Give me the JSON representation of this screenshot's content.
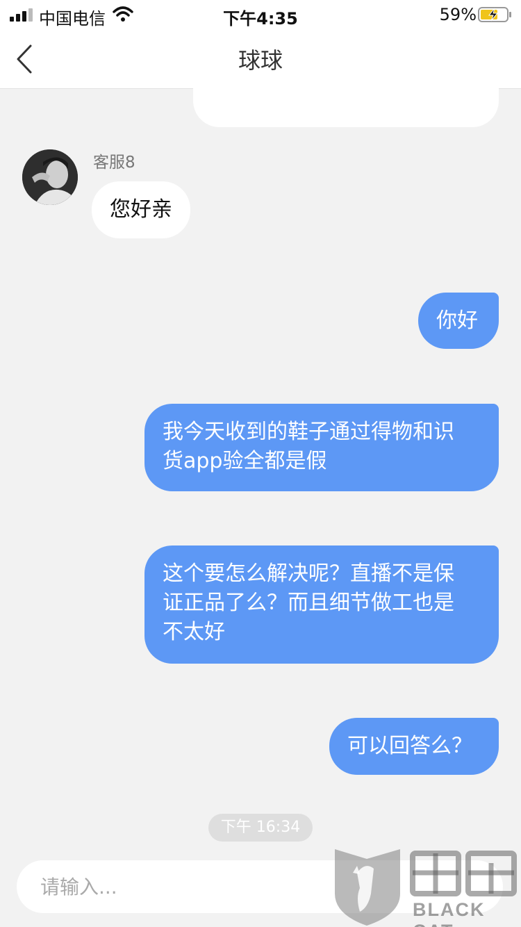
{
  "status_bar": {
    "carrier": "中国电信",
    "time": "下午4:35",
    "battery": "59%",
    "icons": [
      "signal-icon",
      "wifi-icon",
      "battery-charging-icon"
    ]
  },
  "nav": {
    "title": "球球",
    "back_icon": "chevron-left-icon"
  },
  "messages": [
    {
      "direction": "in",
      "sender": "客服8",
      "text": "您好亲"
    },
    {
      "direction": "out",
      "text": "你好"
    },
    {
      "direction": "out",
      "lines": [
        "我今天收到的鞋子通过得物和识",
        "货app验全都是假"
      ]
    },
    {
      "direction": "out",
      "lines": [
        "这个要怎么解决呢？直播不是保",
        "证正品了么？而且细节做工也是",
        "不太好"
      ]
    },
    {
      "direction": "out",
      "text": "可以回答么？"
    }
  ],
  "timestamp": "下午 16:34",
  "input": {
    "placeholder": "请输入..."
  },
  "watermark": {
    "text": "BLACK CAT",
    "logo_chars": "黑猫"
  },
  "colors": {
    "outgoing_bubble": "#5d98f5",
    "incoming_bubble": "#ffffff",
    "background": "#f2f2f2"
  }
}
